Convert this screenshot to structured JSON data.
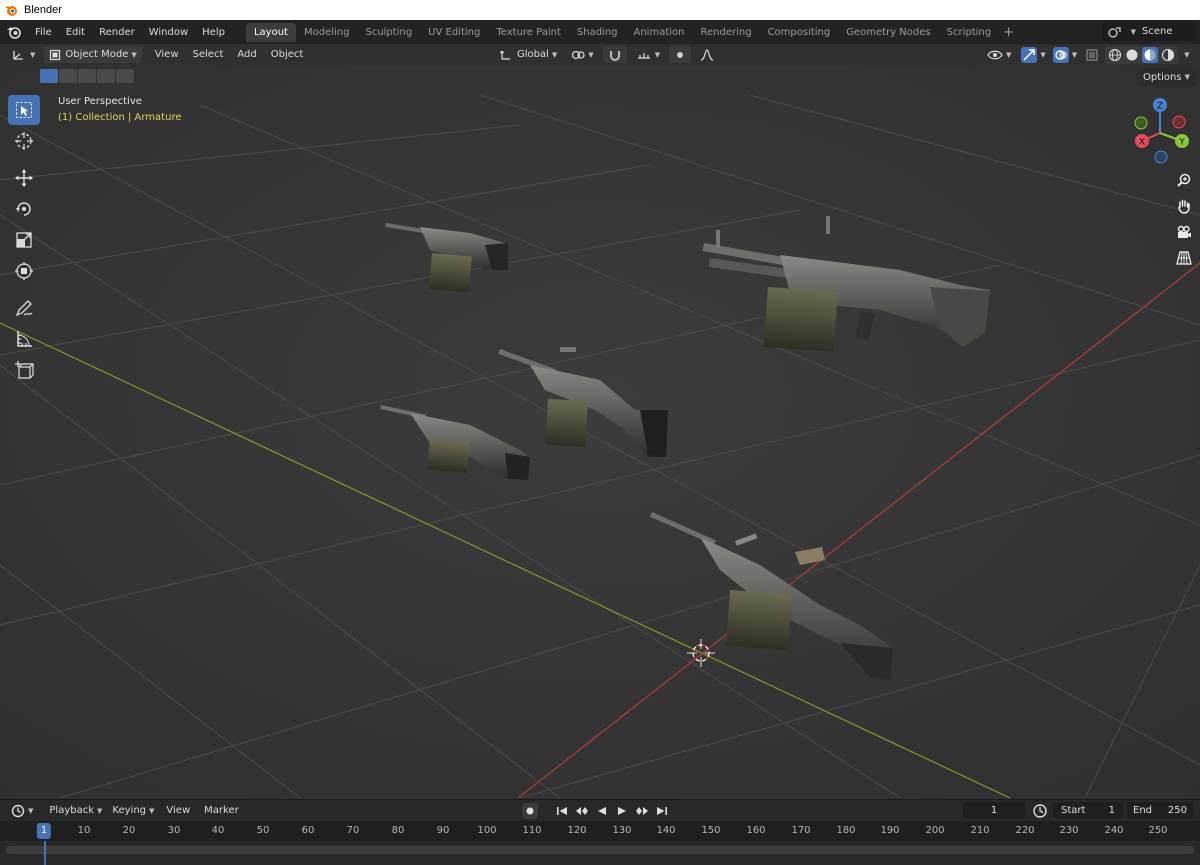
{
  "window": {
    "title": "Blender"
  },
  "topbar": {
    "menus": [
      "File",
      "Edit",
      "Render",
      "Window",
      "Help"
    ],
    "workspaces": [
      "Layout",
      "Modeling",
      "Sculpting",
      "UV Editing",
      "Texture Paint",
      "Shading",
      "Animation",
      "Rendering",
      "Compositing",
      "Geometry Nodes",
      "Scripting"
    ],
    "active_workspace": "Layout",
    "add_workspace": "+",
    "scene_value": "Scene"
  },
  "viewport_header": {
    "mode": "Object Mode",
    "menus": [
      "View",
      "Select",
      "Add",
      "Object"
    ],
    "transform_orientation": "Global",
    "options_label": "Options"
  },
  "viewport": {
    "view_label": "User Perspective",
    "collection_label": "(1) Collection | Armature",
    "gizmo": {
      "z": "Z",
      "x": "X",
      "y": "Y"
    },
    "colors": {
      "background": "#393939",
      "x_axis": "#c0403f",
      "y_axis": "#8bac2a",
      "grid": "#4a4a4a",
      "active_tool": "#4772b3"
    }
  },
  "toolbar": {
    "tools": [
      "select-box",
      "cursor",
      "move",
      "rotate",
      "scale",
      "transform",
      "annotate",
      "measure",
      "add-cube"
    ],
    "active": "select-box"
  },
  "timeline": {
    "menus": [
      "Playback",
      "Keying",
      "View",
      "Marker"
    ],
    "current_frame": "1",
    "start_label": "Start",
    "start_value": "1",
    "end_label": "End",
    "end_value": "250",
    "ruler_ticks": [
      "10",
      "20",
      "30",
      "40",
      "50",
      "60",
      "70",
      "80",
      "90",
      "100",
      "110",
      "120",
      "130",
      "140",
      "150",
      "160",
      "170",
      "180",
      "190",
      "200",
      "210",
      "220",
      "230",
      "240",
      "250"
    ],
    "current_marker": "1"
  }
}
